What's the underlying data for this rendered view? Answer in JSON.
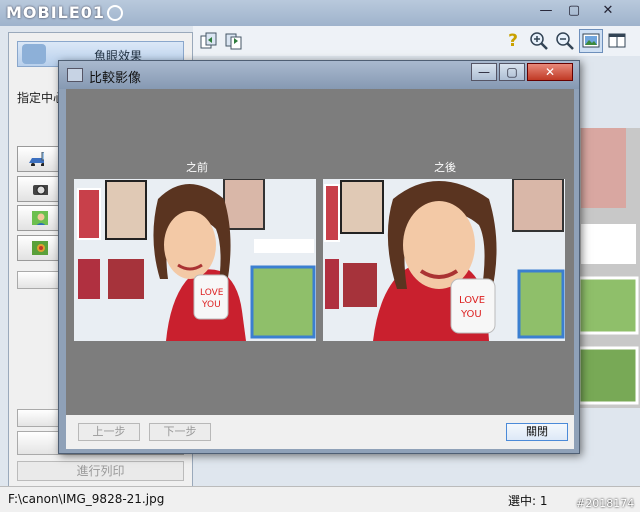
{
  "app": {
    "logo": "MOBILE01",
    "window_controls": {
      "minimize": "—",
      "maximize": "▢",
      "close": "✕"
    }
  },
  "left_panel": {
    "fisheye_tab_label": "魚眼效果",
    "center_label": "指定中心",
    "print_button_label": "進行列印"
  },
  "toolbar": {
    "help_glyph": "?"
  },
  "dialog": {
    "title": "比較影像",
    "before_label": "之前",
    "after_label": "之後",
    "prev_button": "上一步",
    "next_button": "下一步",
    "close_button": "關閉",
    "controls": {
      "minimize": "—",
      "maximize": "▢",
      "close": "✕"
    }
  },
  "statusbar": {
    "path": "F:\\canon\\IMG_9828-21.jpg",
    "selection": "選中: 1"
  },
  "watermark": "#2018174",
  "icons": {
    "fisheye": "fisheye-icon",
    "car": "car-icon",
    "camera": "camera-icon",
    "person": "person-icon",
    "landscape": "landscape-icon",
    "copy": "copy-icon",
    "paste": "paste-icon",
    "zoom_in": "zoom-in-icon",
    "zoom_out": "zoom-out-icon",
    "image": "image-icon",
    "window": "window-icon"
  },
  "colors": {
    "accent": "#4b8ad8",
    "dialog_close": "#c03a25",
    "content_bg": "#7d7d7d"
  }
}
